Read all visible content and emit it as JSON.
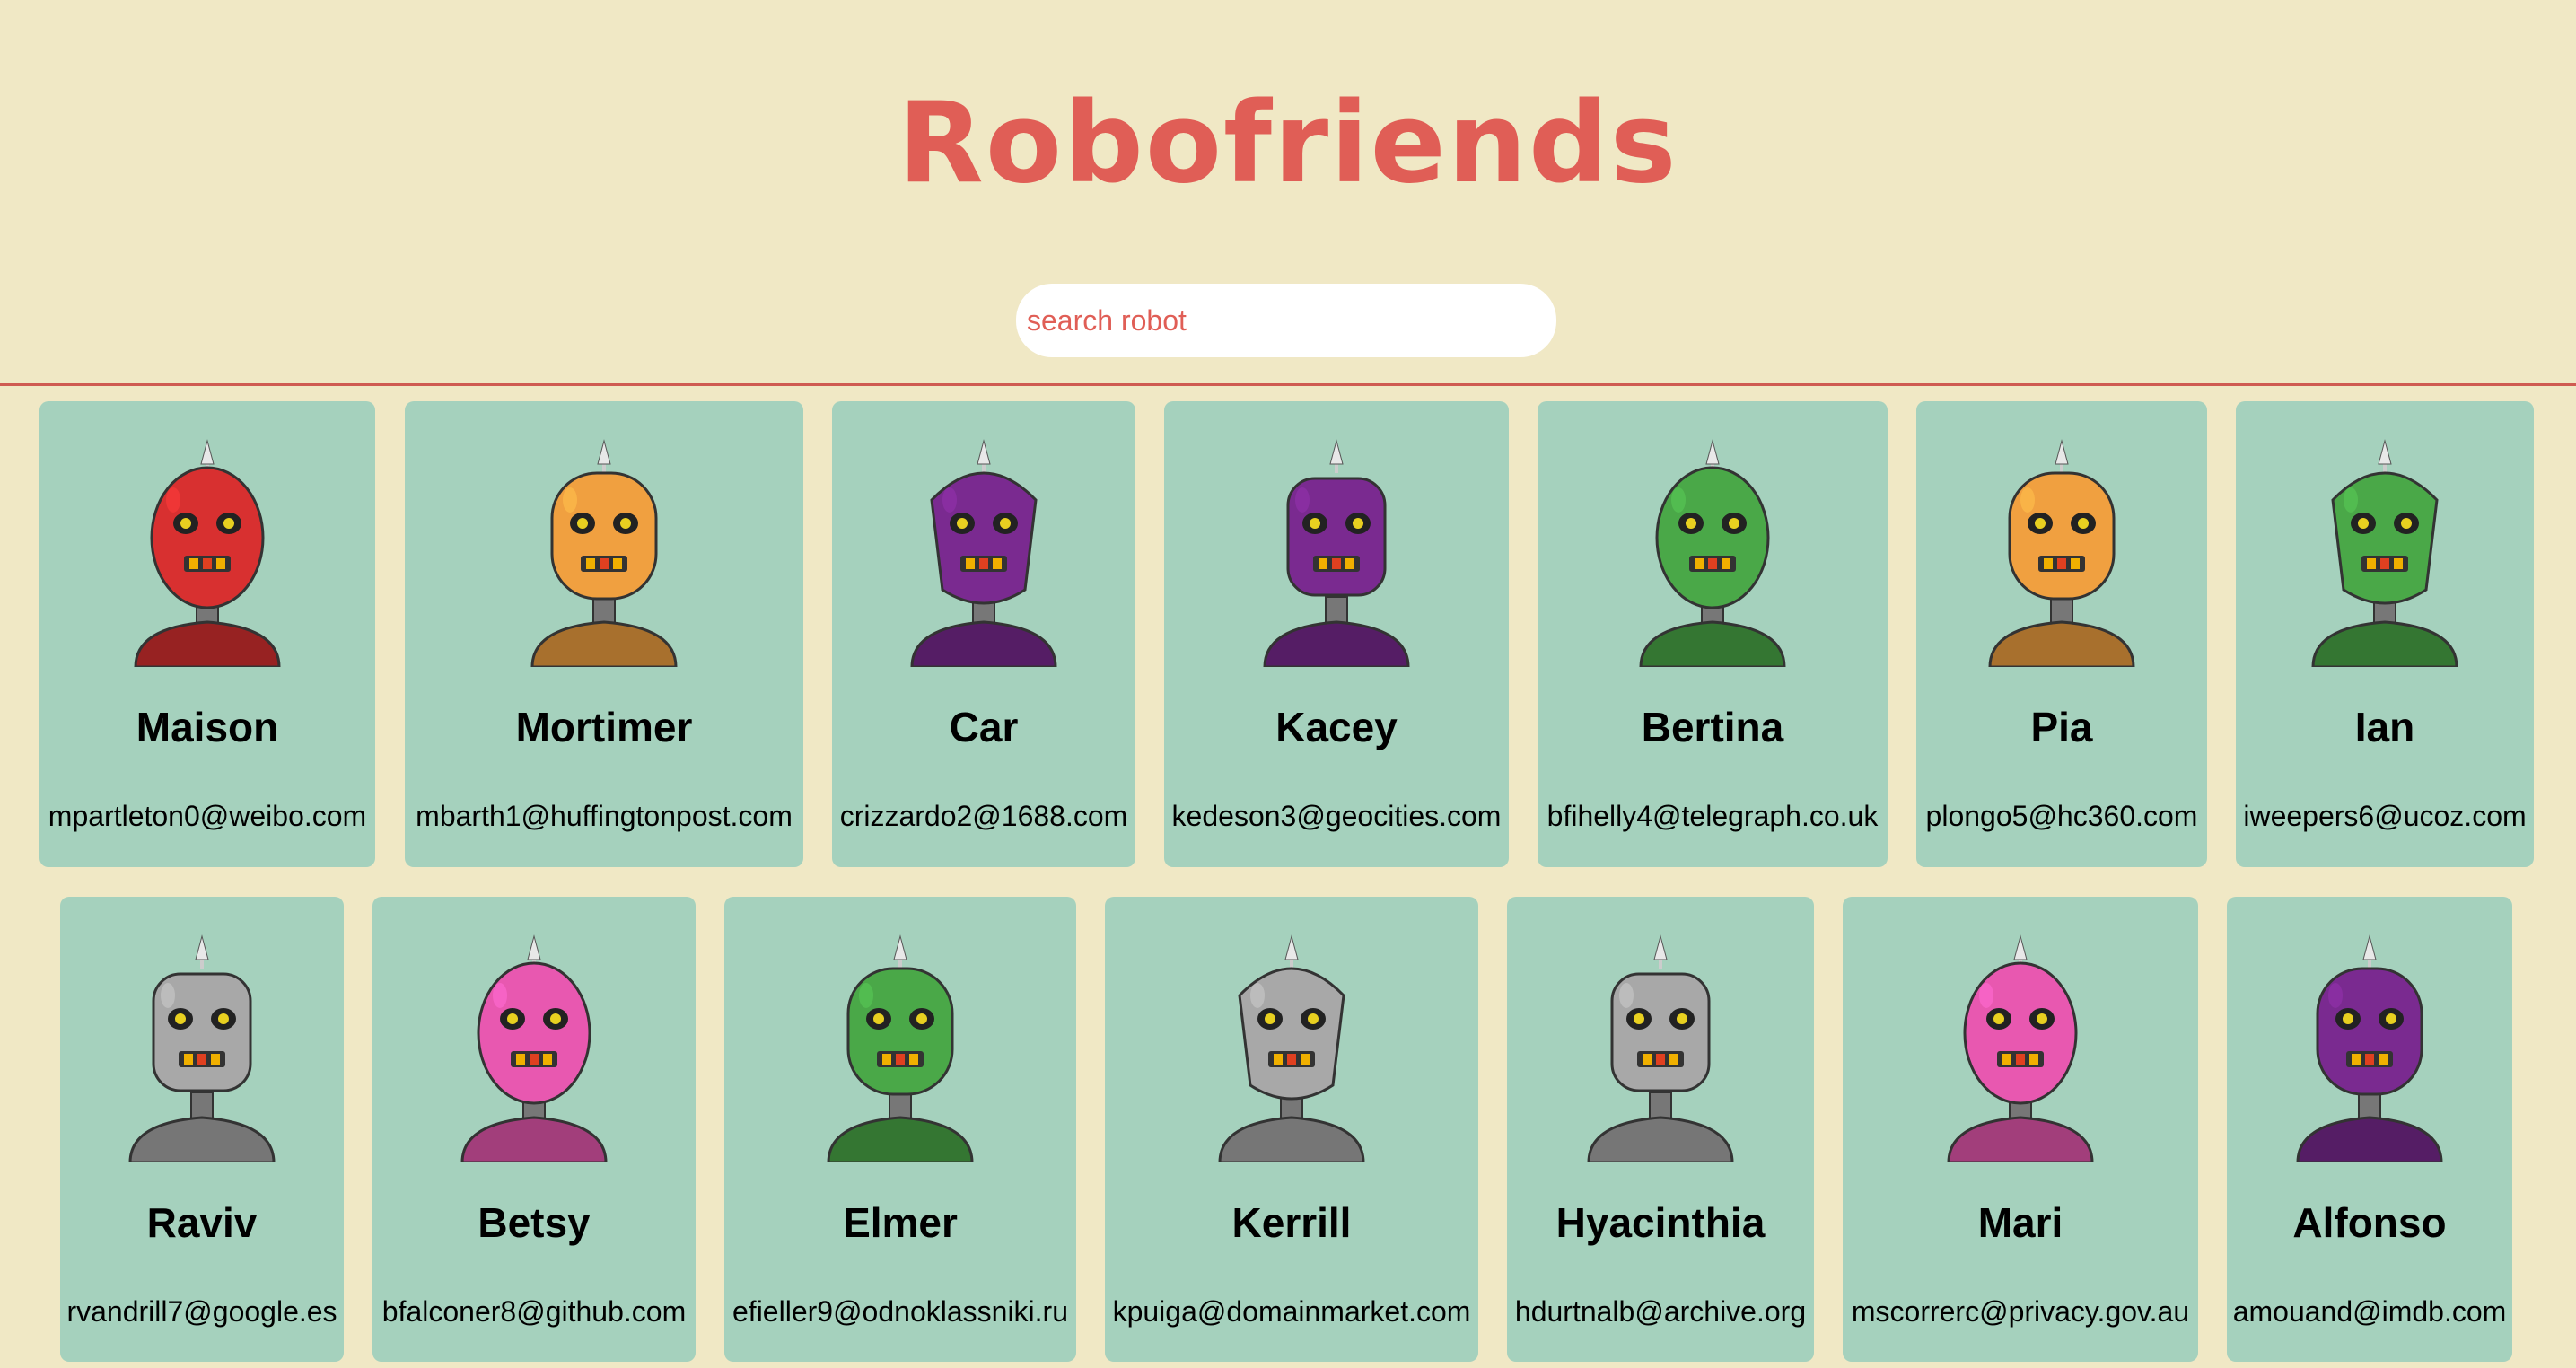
{
  "header": {
    "title": "Robofriends",
    "search_placeholder": "search robot",
    "search_value": ""
  },
  "colors": {
    "background": "#f0e8c5",
    "title": "#e05e56",
    "card": "#a5d1bd",
    "divider": "#cf5b52"
  },
  "robots": [
    {
      "name": "Maison",
      "email": "mpartleton0@weibo.com",
      "color": "#d83030"
    },
    {
      "name": "Mortimer",
      "email": "mbarth1@huffingtonpost.com",
      "color": "#f0a040"
    },
    {
      "name": "Car",
      "email": "crizzardo2@1688.com",
      "color": "#7a2a90"
    },
    {
      "name": "Kacey",
      "email": "kedeson3@geocities.com",
      "color": "#7a2a90"
    },
    {
      "name": "Bertina",
      "email": "bfihelly4@telegraph.co.uk",
      "color": "#4aa848"
    },
    {
      "name": "Pia",
      "email": "plongo5@hc360.com",
      "color": "#f0a040"
    },
    {
      "name": "Ian",
      "email": "iweepers6@ucoz.com",
      "color": "#4aa848"
    },
    {
      "name": "Raviv",
      "email": "rvandrill7@google.es",
      "color": "#a8a8a8"
    },
    {
      "name": "Betsy",
      "email": "bfalconer8@github.com",
      "color": "#e858b0"
    },
    {
      "name": "Elmer",
      "email": "efieller9@odnoklassniki.ru",
      "color": "#4aa848"
    },
    {
      "name": "Kerrill",
      "email": "kpuiga@domainmarket.com",
      "color": "#a8a8a8"
    },
    {
      "name": "Hyacinthia",
      "email": "hdurtnalb@archive.org",
      "color": "#a8a8a8"
    },
    {
      "name": "Mari",
      "email": "mscorrerc@privacy.gov.au",
      "color": "#e858b0"
    },
    {
      "name": "Alfonso",
      "email": "amouand@imdb.com",
      "color": "#7a2a90"
    }
  ]
}
